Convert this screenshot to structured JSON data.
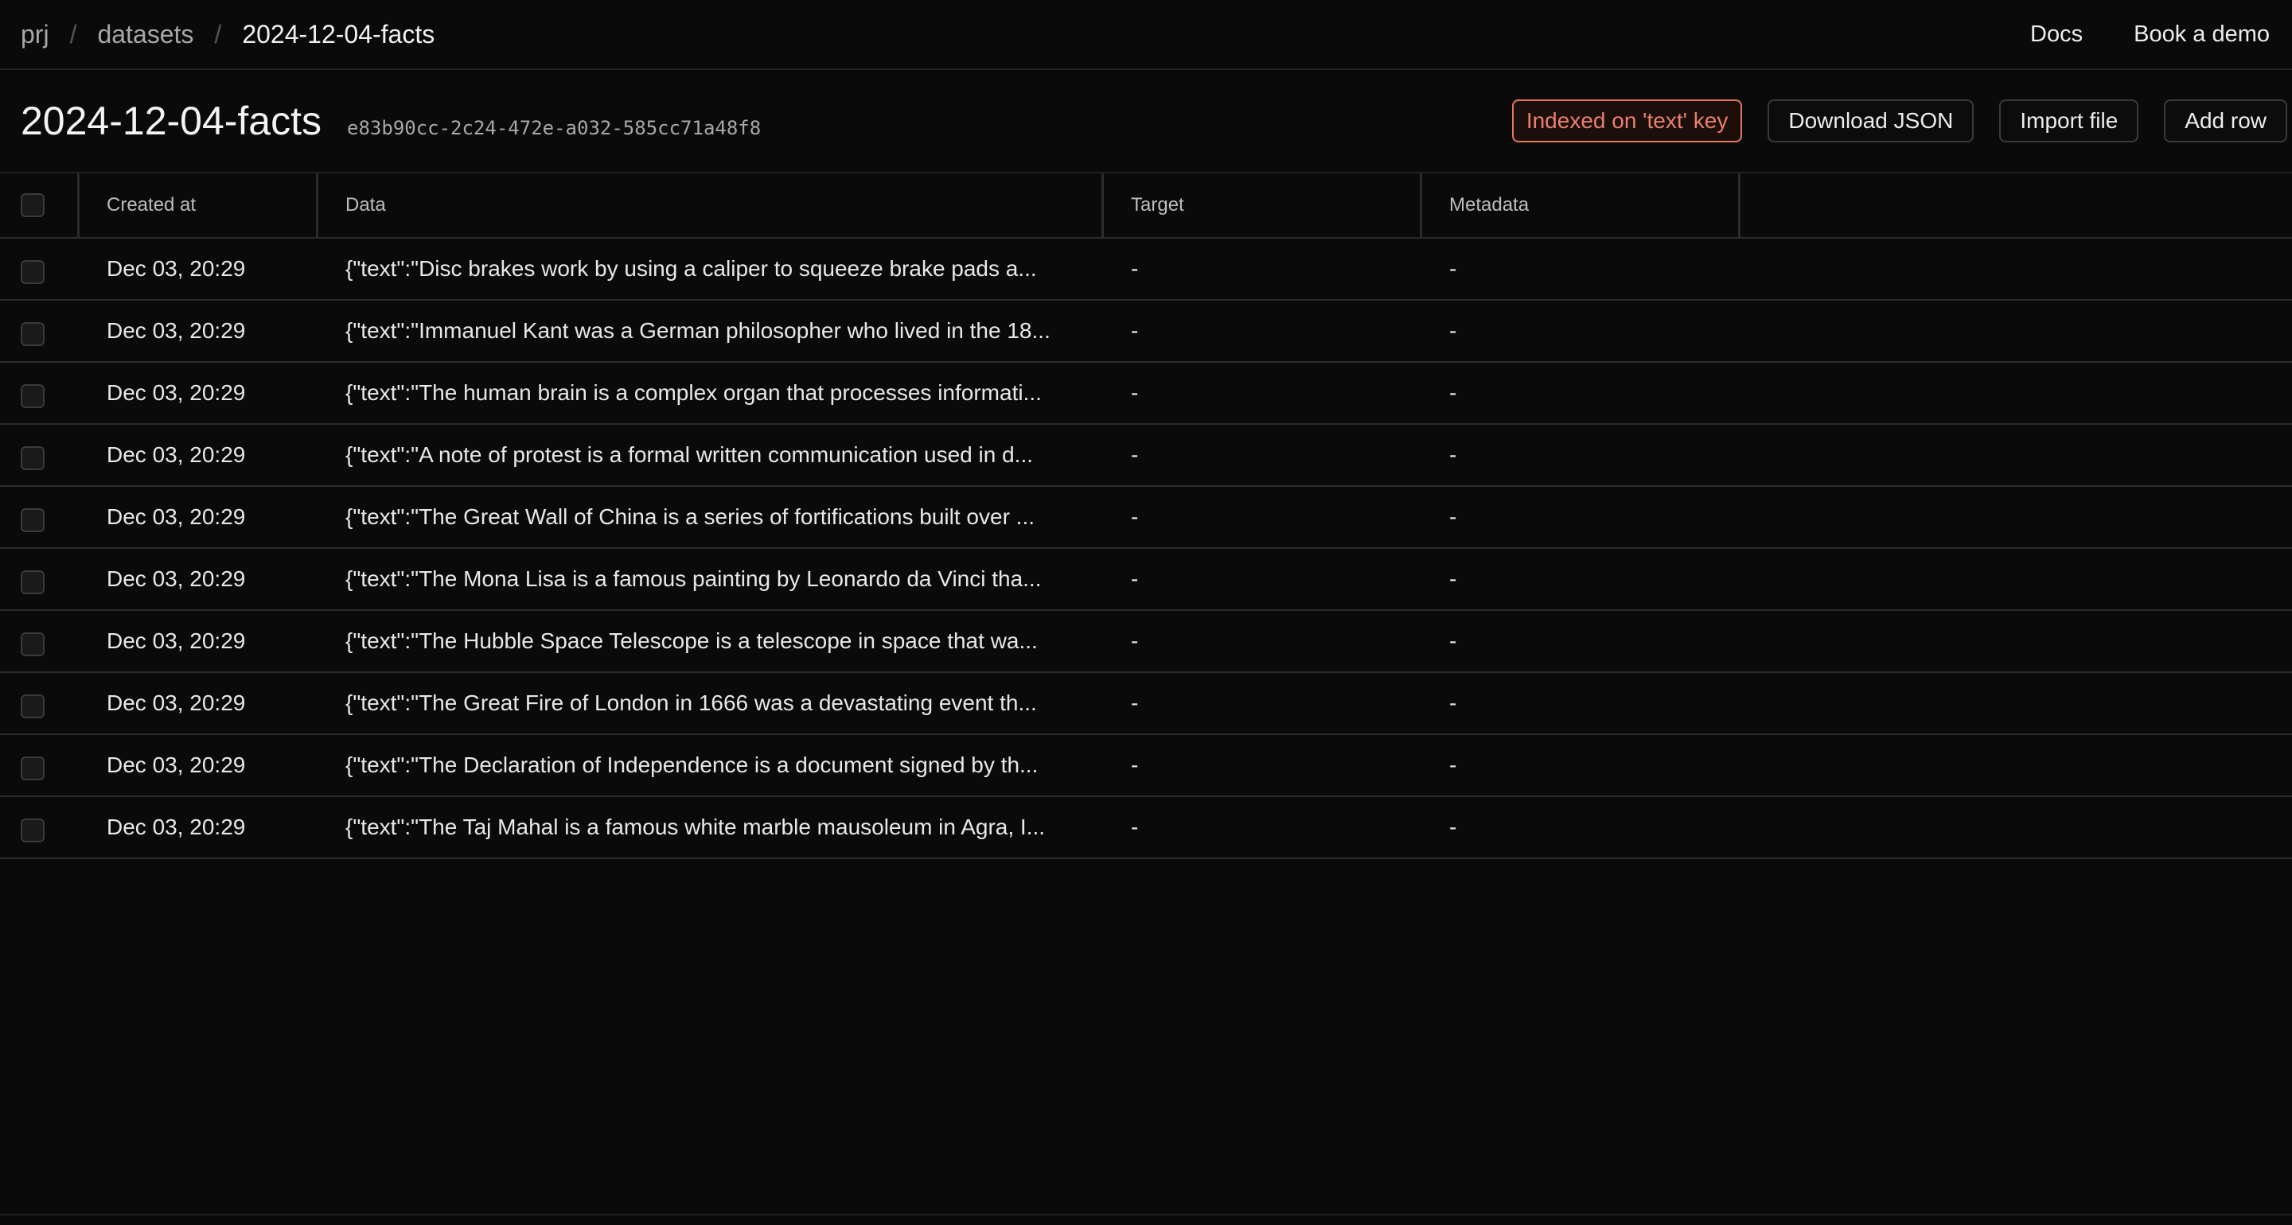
{
  "breadcrumb": {
    "project": "prj",
    "section": "datasets",
    "current": "2024-12-04-facts",
    "separator": "/"
  },
  "topnav": {
    "docs": "Docs",
    "book_demo": "Book a demo"
  },
  "header": {
    "title": "2024-12-04-facts",
    "dataset_id": "e83b90cc-2c24-472e-a032-585cc71a48f8",
    "indexed_badge": "Indexed on 'text' key",
    "download_json": "Download JSON",
    "import_file": "Import file",
    "add_row": "Add row"
  },
  "table": {
    "columns": [
      "Created at",
      "Data",
      "Target",
      "Metadata"
    ],
    "rows": [
      {
        "created": "Dec 03, 20:29",
        "data": "{\"text\":\"Disc brakes work by using a caliper to squeeze brake pads a...",
        "target": "-",
        "metadata": "-"
      },
      {
        "created": "Dec 03, 20:29",
        "data": "{\"text\":\"Immanuel Kant was a German philosopher who lived in the 18...",
        "target": "-",
        "metadata": "-"
      },
      {
        "created": "Dec 03, 20:29",
        "data": "{\"text\":\"The human brain is a complex organ that processes informati...",
        "target": "-",
        "metadata": "-"
      },
      {
        "created": "Dec 03, 20:29",
        "data": "{\"text\":\"A note of protest is a formal written communication used in d...",
        "target": "-",
        "metadata": "-"
      },
      {
        "created": "Dec 03, 20:29",
        "data": "{\"text\":\"The Great Wall of China is a series of fortifications built over ...",
        "target": "-",
        "metadata": "-"
      },
      {
        "created": "Dec 03, 20:29",
        "data": "{\"text\":\"The Mona Lisa is a famous painting by Leonardo da Vinci tha...",
        "target": "-",
        "metadata": "-"
      },
      {
        "created": "Dec 03, 20:29",
        "data": "{\"text\":\"The Hubble Space Telescope is a telescope in space that wa...",
        "target": "-",
        "metadata": "-"
      },
      {
        "created": "Dec 03, 20:29",
        "data": "{\"text\":\"The Great Fire of London in 1666 was a devastating event th...",
        "target": "-",
        "metadata": "-"
      },
      {
        "created": "Dec 03, 20:29",
        "data": "{\"text\":\"The Declaration of Independence is a document signed by th...",
        "target": "-",
        "metadata": "-"
      },
      {
        "created": "Dec 03, 20:29",
        "data": "{\"text\":\"The Taj Mahal is a famous white marble mausoleum in Agra, I...",
        "target": "-",
        "metadata": "-"
      }
    ]
  },
  "colors": {
    "background": "#0a0a0a",
    "badge_accent": "#e07b5e"
  }
}
